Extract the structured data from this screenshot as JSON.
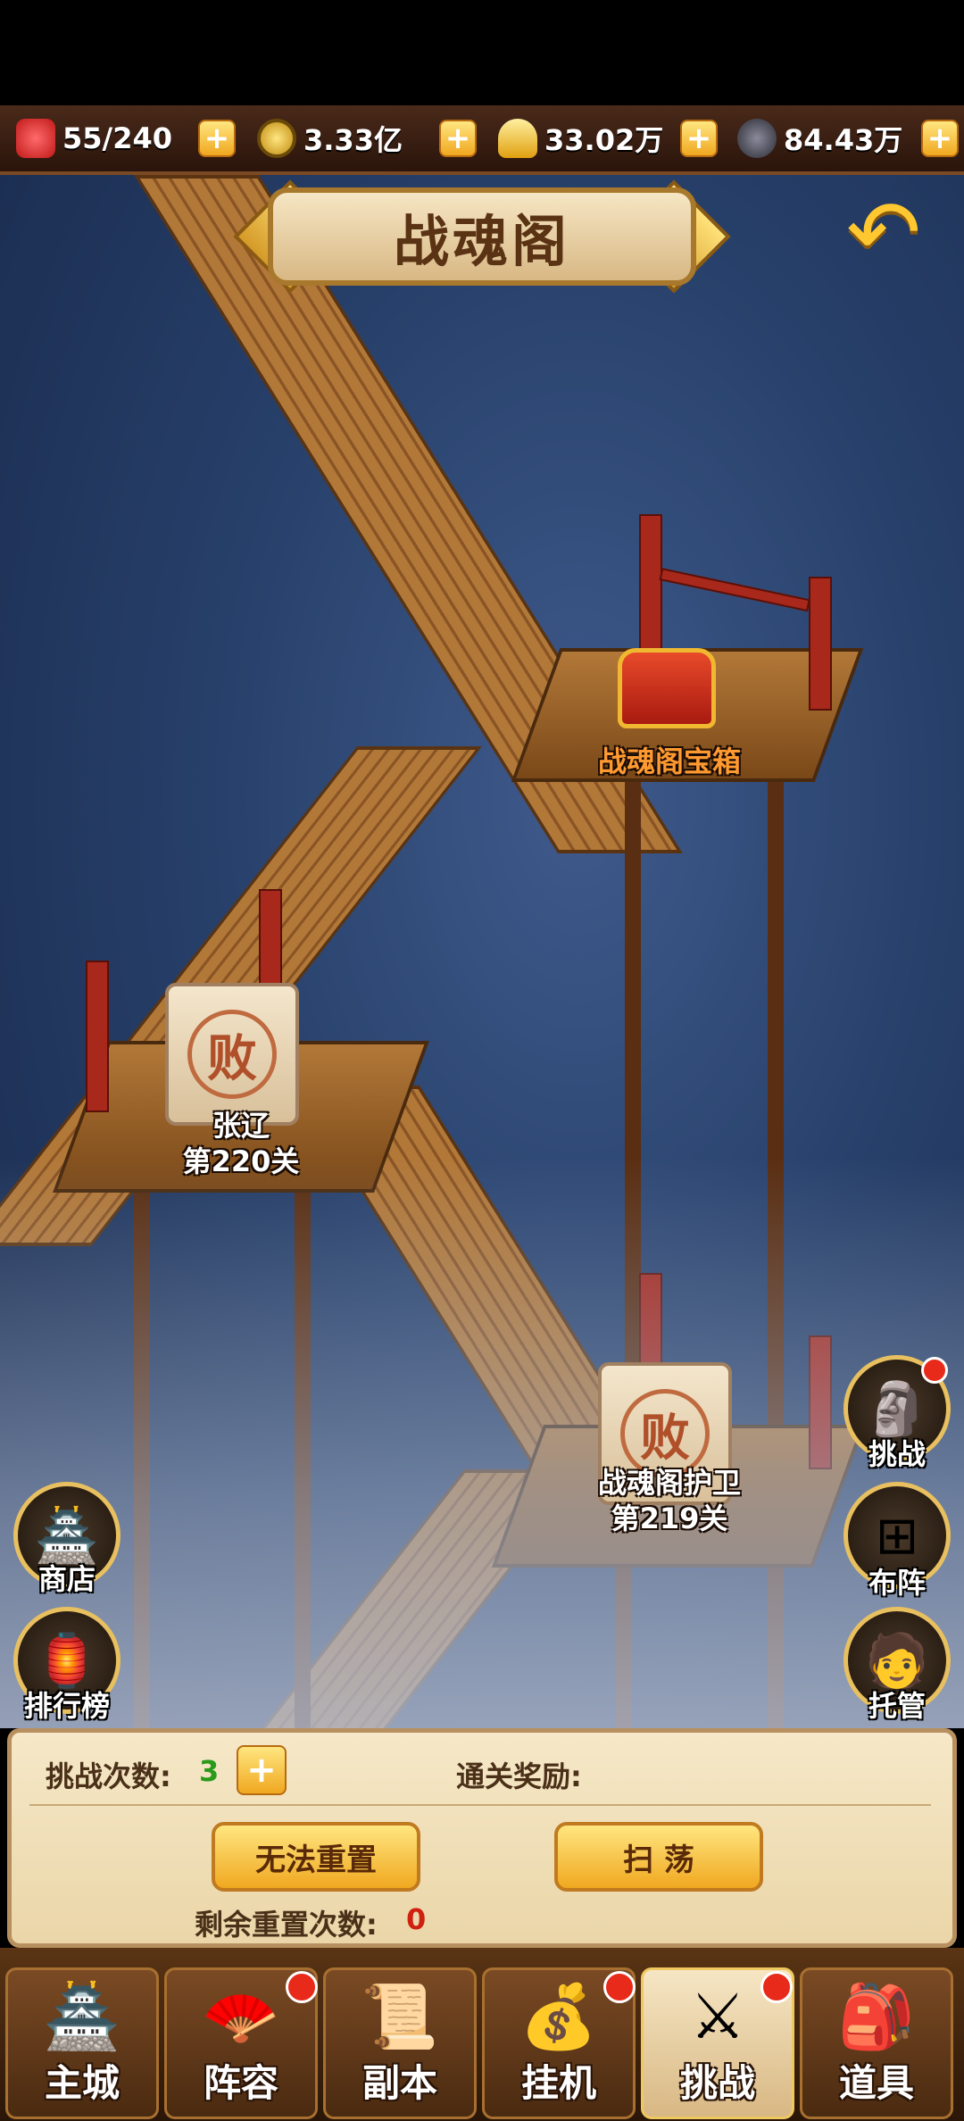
{
  "top_bar": {
    "stamina": "55/240",
    "copper": "3.33亿",
    "gold": "33.02万",
    "iron": "84.43万"
  },
  "title": "战魂阁",
  "scene": {
    "chest_label": "战魂阁宝箱",
    "stage_upper": {
      "name": "张辽",
      "level": "第220关",
      "seal": "败"
    },
    "stage_lower": {
      "name": "战魂阁护卫",
      "level": "第219关",
      "seal": "败"
    }
  },
  "left_buttons": {
    "shop": "商店",
    "ranking": "排行榜"
  },
  "right_buttons": {
    "challenge": "挑战",
    "formation": "布阵",
    "auto": "托管"
  },
  "panel": {
    "attempts_label": "挑战次数:",
    "attempts_value": "3",
    "reward_label": "通关奖励:",
    "reset_button": "无法重置",
    "sweep_button": "扫 荡",
    "resets_left_label": "剩余重置次数:",
    "resets_left_value": "0"
  },
  "nav": [
    "主城",
    "阵容",
    "副本",
    "挂机",
    "挑战",
    "道具"
  ],
  "colors": {
    "accent_gold": "#f0a820",
    "wood": "#8a5424",
    "value_green": "#2a9a1a",
    "value_red": "#d02010"
  }
}
